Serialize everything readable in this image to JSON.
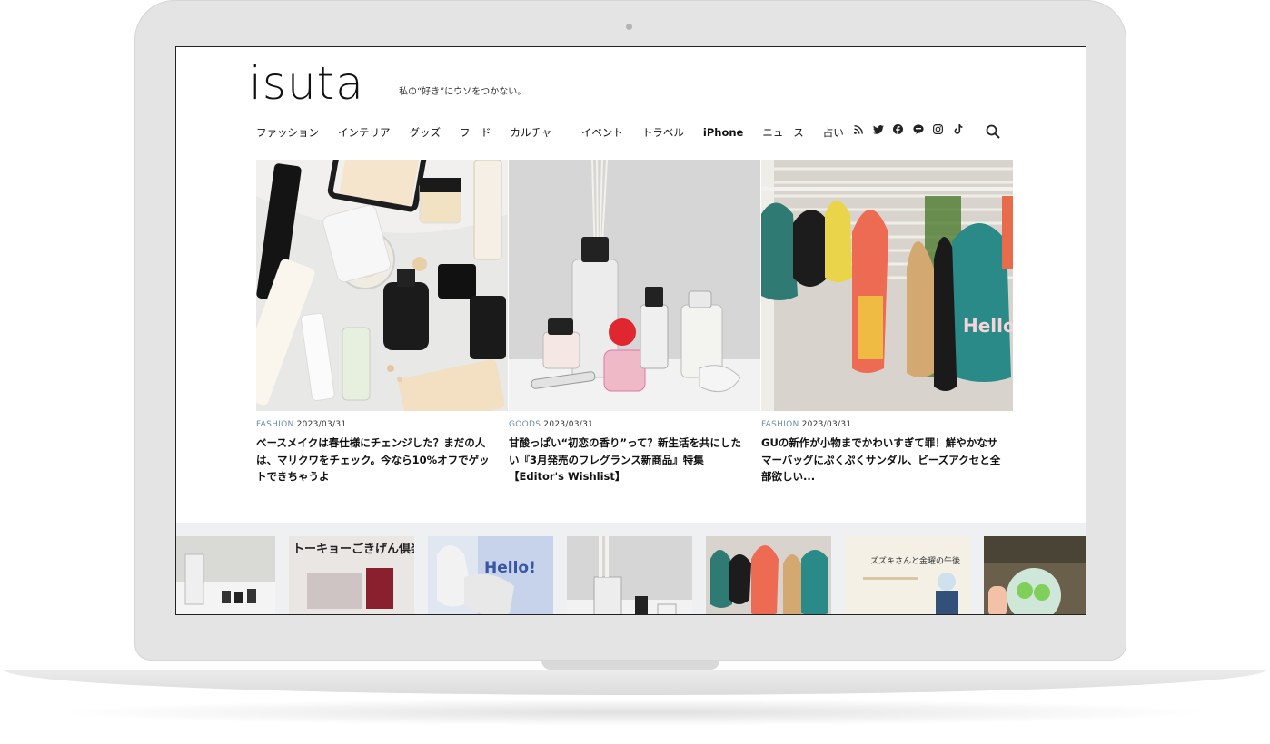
{
  "site": {
    "logo": "isuta",
    "tagline": "私の“好き”にウソをつかない。"
  },
  "nav": {
    "items": [
      "ファッション",
      "インテリア",
      "グッズ",
      "フード",
      "カルチャー",
      "イベント",
      "トラベル",
      "iPhone",
      "ニュース",
      "占い"
    ],
    "social_icons": [
      "rss-icon",
      "twitter-icon",
      "facebook-icon",
      "line-icon",
      "instagram-icon",
      "tiktok-icon"
    ],
    "search_icon": "search-icon"
  },
  "articles": [
    {
      "category": "FASHION",
      "date": "2023/03/31",
      "title": "ベースメイクは春仕様にチェンジした？まだの人は、マリクワをチェック。今なら10%オフでゲットできちゃうよ"
    },
    {
      "category": "GOODS",
      "date": "2023/03/31",
      "title": "甘酸っぱい“初恋の香り”って？新生活を共にしたい『3月発売のフレグランス新商品』特集【Editor's Wishlist】"
    },
    {
      "category": "FASHION",
      "date": "2023/03/31",
      "title": "GUの新作が小物までかわいすぎて罪！鮮やかなサマーバッグにぷくぷくサンダル、ビーズアクセと全部欲しい..."
    }
  ],
  "strip": {
    "thumb_texts": [
      "トーキョーごきげん倶楽部",
      "Hello!",
      "ズズキさんと金曜の午後"
    ]
  },
  "colors": {
    "category": "#6e8ea3",
    "strip_bg": "#eef0f2",
    "frame": "#e4e4e4"
  }
}
